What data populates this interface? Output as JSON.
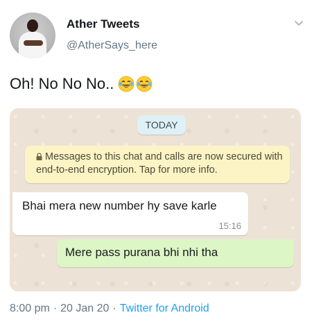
{
  "author": {
    "display_name": "Ather Tweets",
    "handle": "@AtherSays_here"
  },
  "tweet": {
    "text": "Oh! No No No..",
    "emojis": [
      "face-with-tears-of-joy",
      "face-with-tears-of-joy"
    ]
  },
  "chat_screenshot": {
    "date_chip": "TODAY",
    "encryption_notice": "Messages to this chat and calls are now secured with end-to-end encryption. Tap for more info.",
    "messages": [
      {
        "direction": "incoming",
        "text": "Bhai mera new number hy save karle",
        "time": "15:16"
      },
      {
        "direction": "outgoing",
        "text": "Mere pass purana bhi nhi tha"
      }
    ]
  },
  "meta": {
    "time": "8:00 pm",
    "date": "20 Jan 20",
    "client": "Twitter for Android",
    "separator": "·"
  },
  "colors": {
    "link": "#1da1f2",
    "secondary_text": "#657786",
    "outgoing_bubble": "#dcf6c6",
    "notice_bubble": "#fcf4c4"
  }
}
